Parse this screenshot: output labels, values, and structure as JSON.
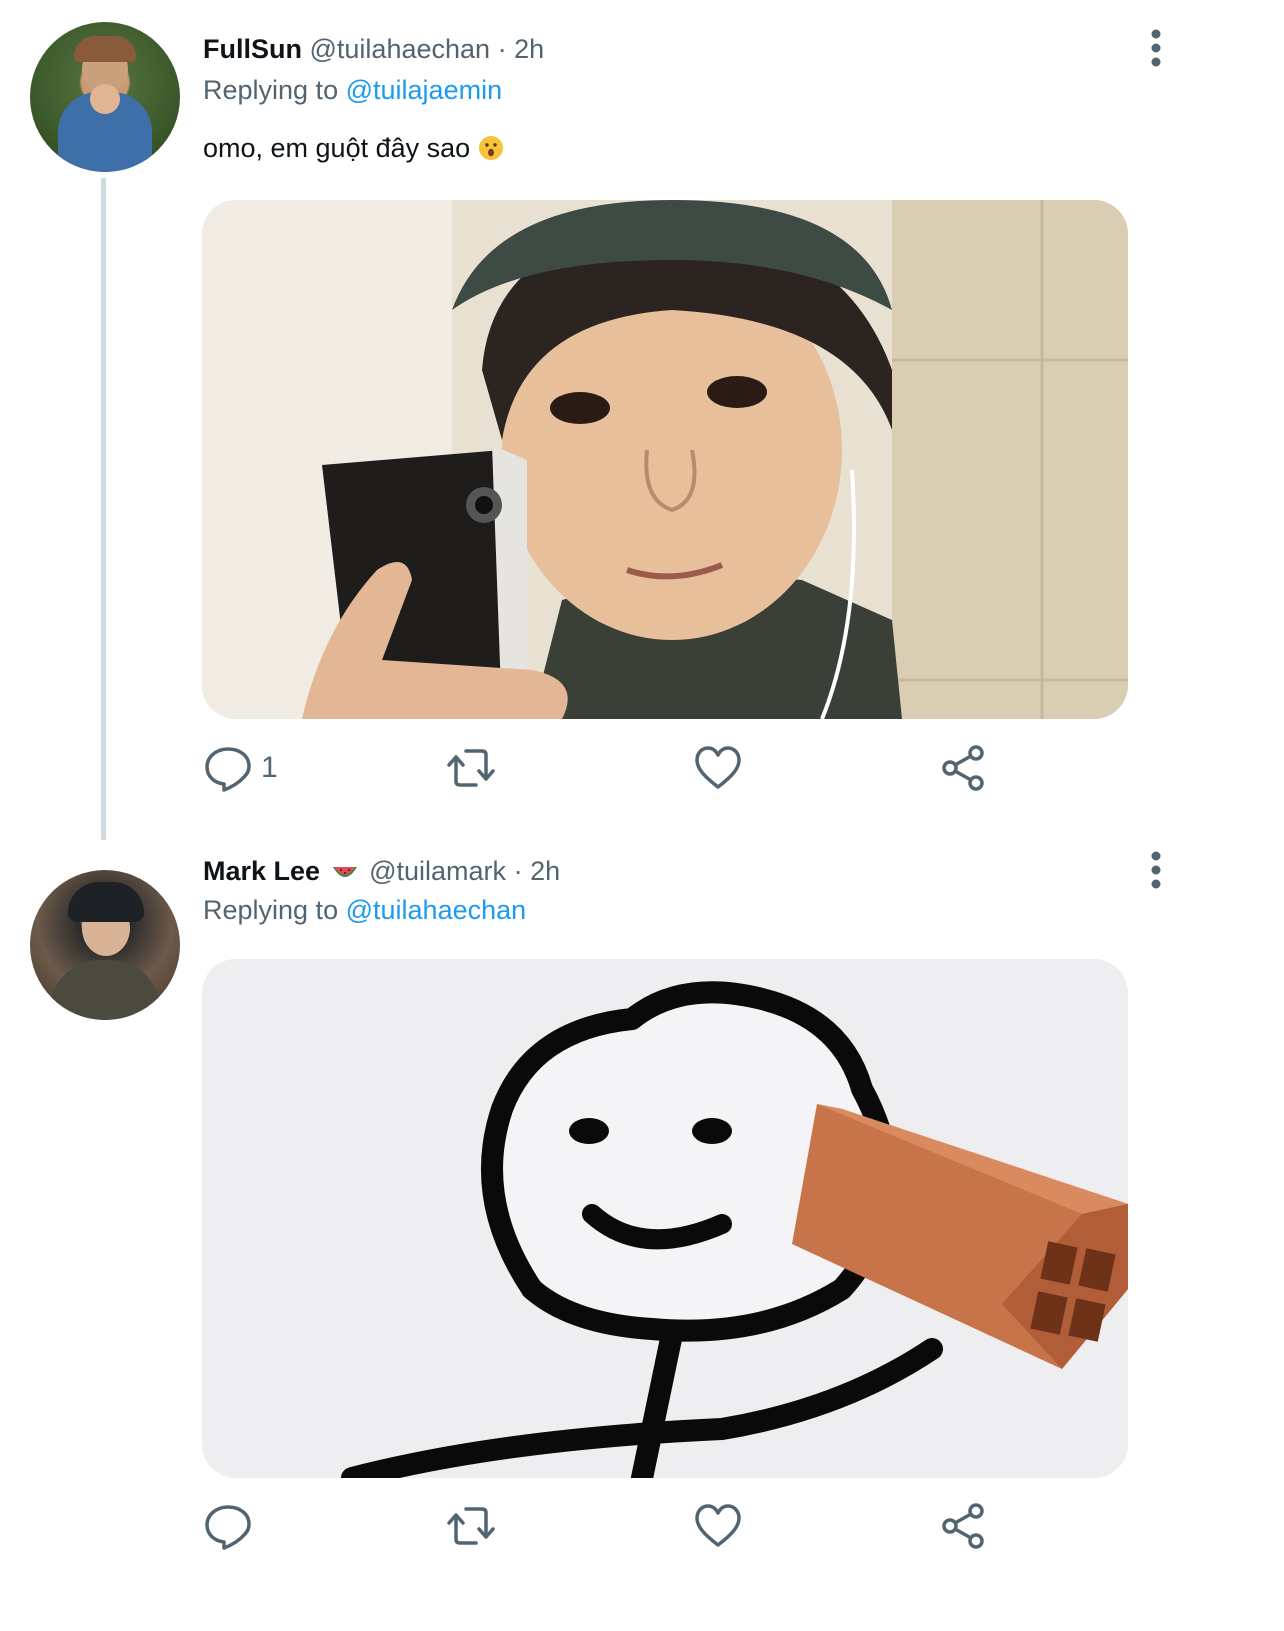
{
  "tweets": [
    {
      "display_name": "FullSun",
      "handle": "@tuilahaechan",
      "separator": "·",
      "time": "2h",
      "replying_prefix": "Replying to",
      "replying_to": "@tuilajaemin",
      "text": "omo, em guột đây sao",
      "text_emoji": "astonished-face",
      "media": "photo of a child in a cap taking a mirror selfie with a phone",
      "reply_count": "1"
    },
    {
      "display_name": "Mark Lee",
      "name_emoji": "watermelon",
      "handle": "@tuilamark",
      "separator": "·",
      "time": "2h",
      "replying_prefix": "Replying to",
      "replying_to": "@tuilahaechan",
      "media": "stick-figure meme hit by a brick",
      "reply_count": ""
    }
  ],
  "icons": {
    "reply": "speech-bubble-icon",
    "retweet": "retweet-icon",
    "like": "heart-icon",
    "share": "share-icon",
    "more": "vertical-dots-icon"
  },
  "colors": {
    "text": "#0f1419",
    "secondary": "#536471",
    "link": "#1d9bf0",
    "thread_line": "#cfd9de"
  }
}
